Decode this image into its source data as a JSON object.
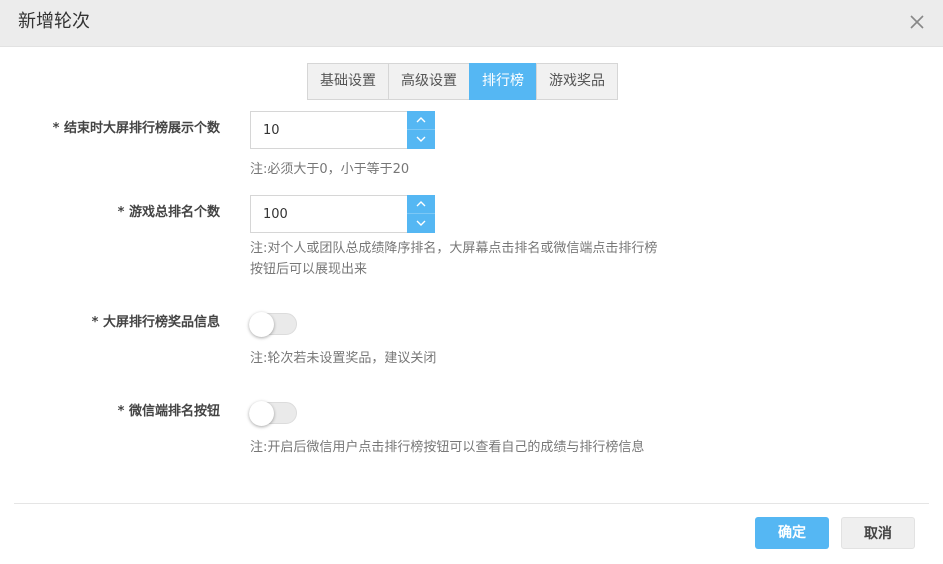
{
  "dialog": {
    "title": "新增轮次"
  },
  "tabs": [
    {
      "label": "基础设置",
      "active": false
    },
    {
      "label": "高级设置",
      "active": false
    },
    {
      "label": "排行榜",
      "active": true
    },
    {
      "label": "游戏奖品",
      "active": false
    }
  ],
  "fields": {
    "screen_rank_count": {
      "label": "* 结束时大屏排行榜展示个数",
      "value": "10",
      "note": "注:必须大于0，小于等于20"
    },
    "total_rank_count": {
      "label": "* 游戏总排名个数",
      "value": "100",
      "note_line1": "注:对个人或团队总成绩降序排名，大屏幕点击排名或微信端点击排行榜",
      "note_line2": "按钮后可以展现出来"
    },
    "screen_prize_info": {
      "label": "* 大屏排行榜奖品信息",
      "enabled": false,
      "note": "注:轮次若未设置奖品，建议关闭"
    },
    "wechat_rank_button": {
      "label": "* 微信端排名按钮",
      "enabled": false,
      "note": "注:开启后微信用户点击排行榜按钮可以查看自己的成绩与排行榜信息"
    }
  },
  "footer": {
    "confirm_label": "确定",
    "cancel_label": "取消"
  },
  "colors": {
    "accent": "#55b7f3",
    "header_bg": "#ececec"
  },
  "icons": {
    "close": "close-icon",
    "spin_up": "chevron-up-icon",
    "spin_down": "chevron-down-icon"
  }
}
